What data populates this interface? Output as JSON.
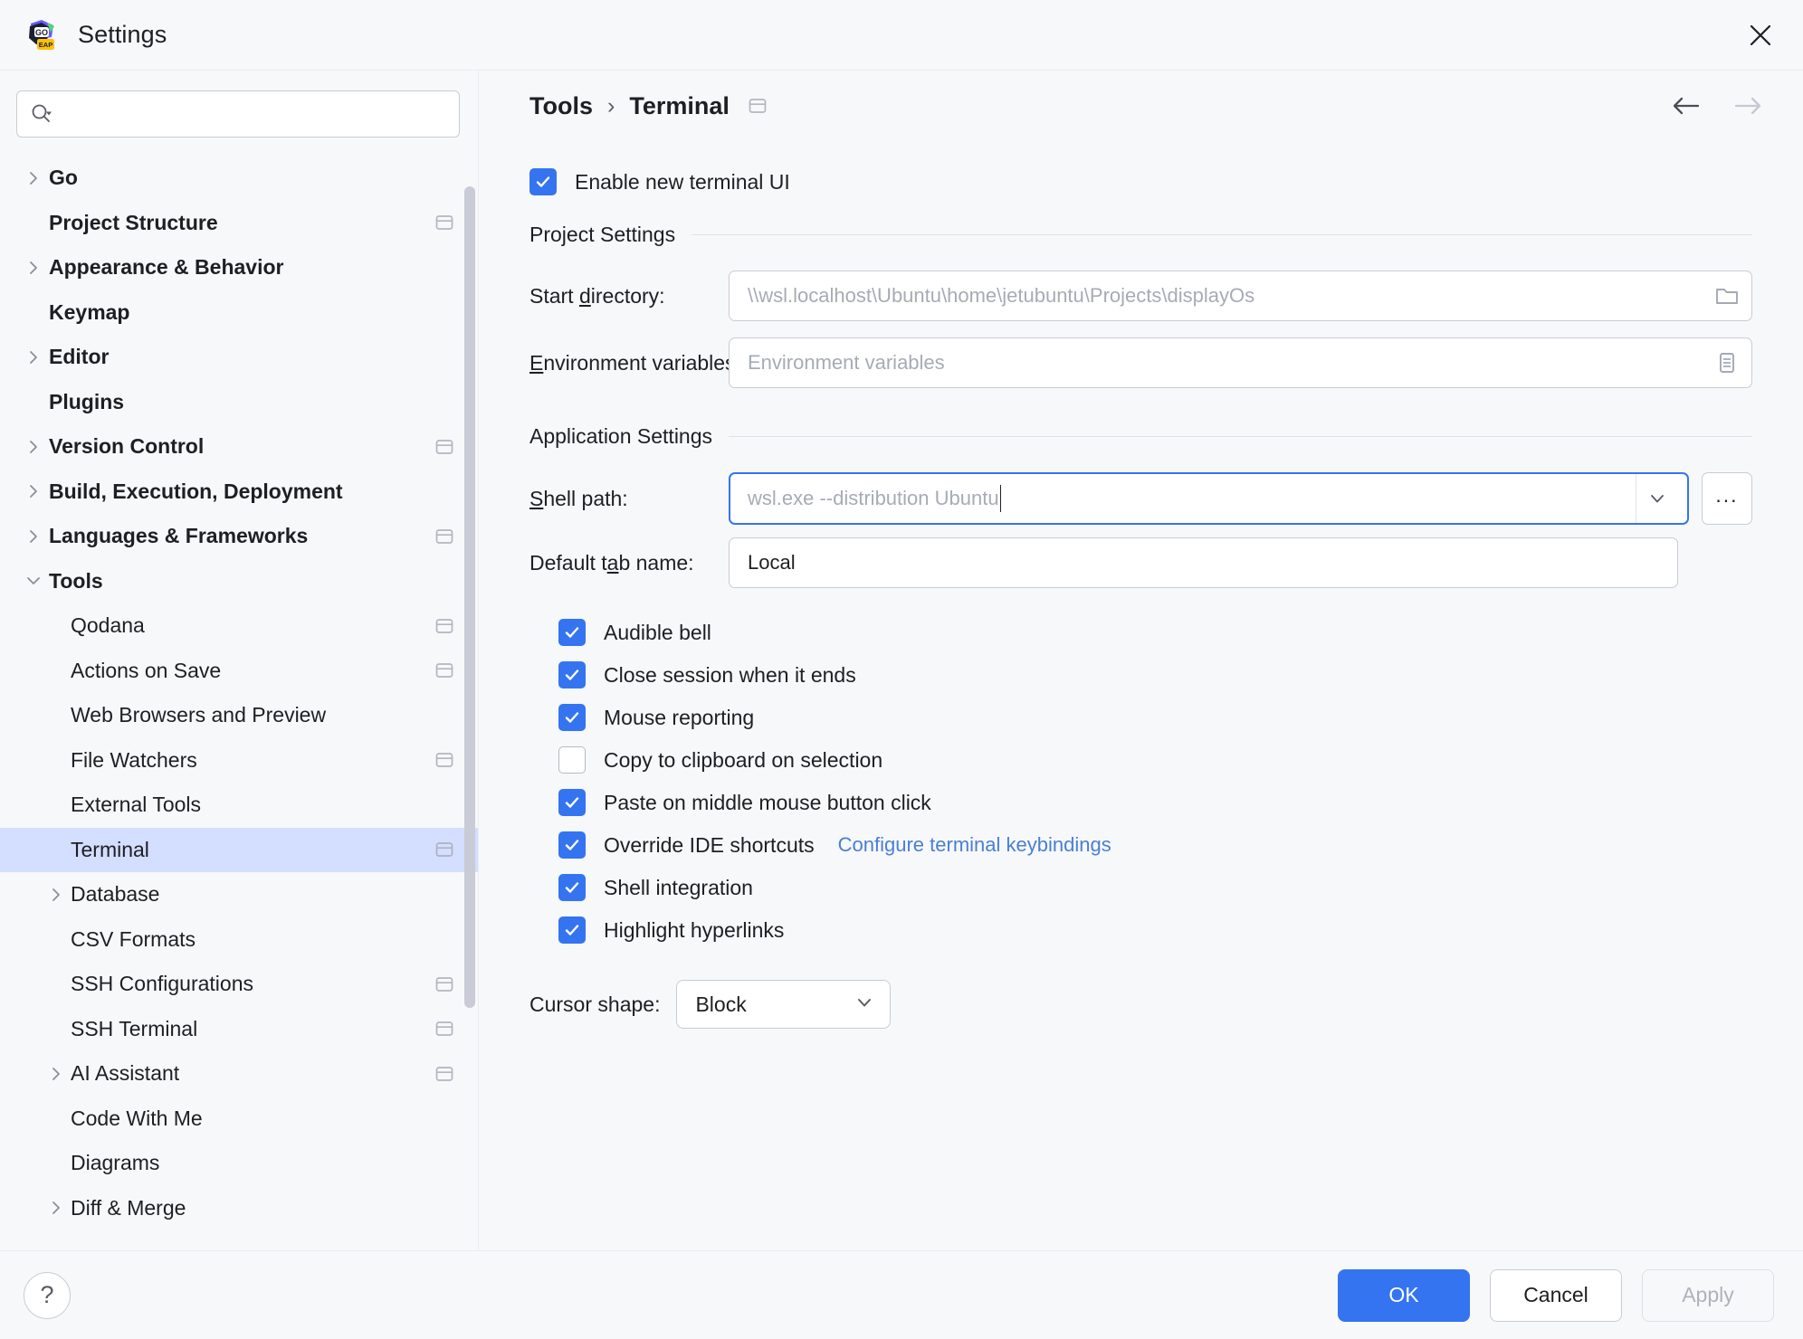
{
  "window": {
    "title": "Settings",
    "app_icon": "goland-eap-icon",
    "close_icon": "close-icon"
  },
  "sidebar": {
    "search": {
      "placeholder": "",
      "value": "",
      "icon": "search-icon"
    },
    "items": [
      {
        "label": "Go",
        "level": 0,
        "chevron": "right",
        "badge": false,
        "selected": false
      },
      {
        "label": "Project Structure",
        "level": 0,
        "chevron": "none",
        "badge": true,
        "selected": false
      },
      {
        "label": "Appearance & Behavior",
        "level": 0,
        "chevron": "right",
        "badge": false,
        "selected": false
      },
      {
        "label": "Keymap",
        "level": 0,
        "chevron": "none",
        "badge": false,
        "selected": false
      },
      {
        "label": "Editor",
        "level": 0,
        "chevron": "right",
        "badge": false,
        "selected": false
      },
      {
        "label": "Plugins",
        "level": 0,
        "chevron": "none",
        "badge": false,
        "selected": false
      },
      {
        "label": "Version Control",
        "level": 0,
        "chevron": "right",
        "badge": true,
        "selected": false
      },
      {
        "label": "Build, Execution, Deployment",
        "level": 0,
        "chevron": "right",
        "badge": false,
        "selected": false
      },
      {
        "label": "Languages & Frameworks",
        "level": 0,
        "chevron": "right",
        "badge": true,
        "selected": false
      },
      {
        "label": "Tools",
        "level": 0,
        "chevron": "down",
        "badge": false,
        "selected": false
      },
      {
        "label": "Qodana",
        "level": 1,
        "chevron": "none",
        "badge": true,
        "selected": false
      },
      {
        "label": "Actions on Save",
        "level": 1,
        "chevron": "none",
        "badge": true,
        "selected": false
      },
      {
        "label": "Web Browsers and Preview",
        "level": 1,
        "chevron": "none",
        "badge": false,
        "selected": false
      },
      {
        "label": "File Watchers",
        "level": 1,
        "chevron": "none",
        "badge": true,
        "selected": false
      },
      {
        "label": "External Tools",
        "level": 1,
        "chevron": "none",
        "badge": false,
        "selected": false
      },
      {
        "label": "Terminal",
        "level": 1,
        "chevron": "none",
        "badge": true,
        "selected": true
      },
      {
        "label": "Database",
        "level": 1,
        "chevron": "right",
        "badge": false,
        "selected": false
      },
      {
        "label": "CSV Formats",
        "level": 1,
        "chevron": "none",
        "badge": false,
        "selected": false
      },
      {
        "label": "SSH Configurations",
        "level": 1,
        "chevron": "none",
        "badge": true,
        "selected": false
      },
      {
        "label": "SSH Terminal",
        "level": 1,
        "chevron": "none",
        "badge": true,
        "selected": false
      },
      {
        "label": "AI Assistant",
        "level": 1,
        "chevron": "right",
        "badge": true,
        "selected": false
      },
      {
        "label": "Code With Me",
        "level": 1,
        "chevron": "none",
        "badge": false,
        "selected": false
      },
      {
        "label": "Diagrams",
        "level": 1,
        "chevron": "none",
        "badge": false,
        "selected": false
      },
      {
        "label": "Diff & Merge",
        "level": 1,
        "chevron": "right",
        "badge": false,
        "selected": false
      }
    ]
  },
  "breadcrumb": {
    "root": "Tools",
    "separator": "›",
    "current": "Terminal",
    "badge_icon": "project-scope-icon",
    "back_icon": "arrow-left-icon",
    "forward_icon": "arrow-right-icon"
  },
  "main": {
    "enable_new_terminal_ui": {
      "label": "Enable new terminal UI",
      "checked": true
    },
    "project_settings": {
      "title": "Project Settings",
      "start_directory": {
        "label_pre": "Start ",
        "label_mn": "d",
        "label_post": "irectory:",
        "value": "",
        "placeholder": "\\\\wsl.localhost\\Ubuntu\\home\\jetubuntu\\Projects\\displayOs",
        "icon": "folder-icon"
      },
      "environment_variables": {
        "label_pre": "",
        "label_mn": "E",
        "label_post": "nvironment variables:",
        "value": "",
        "placeholder": "Environment variables",
        "icon": "list-icon"
      }
    },
    "application_settings": {
      "title": "Application Settings",
      "shell_path": {
        "label_pre": "",
        "label_mn": "S",
        "label_post": "hell path:",
        "value": "",
        "placeholder": "wsl.exe --distribution Ubuntu",
        "focused": true,
        "dropdown_icon": "chevron-down-icon",
        "browse_label": "...",
        "has_caret": true
      },
      "default_tab_name": {
        "label_pre": "Default t",
        "label_mn": "a",
        "label_post": "b name:",
        "value": "Local",
        "placeholder": ""
      },
      "checkboxes": [
        {
          "label": "Audible bell",
          "checked": true,
          "link": null
        },
        {
          "label": "Close session when it ends",
          "checked": true,
          "link": null
        },
        {
          "label": "Mouse reporting",
          "checked": true,
          "link": null
        },
        {
          "label": "Copy to clipboard on selection",
          "checked": false,
          "link": null
        },
        {
          "label": "Paste on middle mouse button click",
          "checked": true,
          "link": null
        },
        {
          "label": "Override IDE shortcuts",
          "checked": true,
          "link": "Configure terminal keybindings"
        },
        {
          "label": "Shell integration",
          "checked": true,
          "link": null
        },
        {
          "label": "Highlight hyperlinks",
          "checked": true,
          "link": null
        }
      ],
      "cursor_shape": {
        "label": "Cursor shape:",
        "value": "Block",
        "icon": "chevron-down-icon"
      }
    }
  },
  "footer": {
    "help_label": "?",
    "ok_label": "OK",
    "cancel_label": "Cancel",
    "apply_label": "Apply",
    "apply_disabled": true
  },
  "colors": {
    "accent": "#3574f0",
    "selection": "#d4deff",
    "link": "#4a7fd4",
    "bg": "#f7f8fa",
    "border": "#c9ccd6"
  }
}
